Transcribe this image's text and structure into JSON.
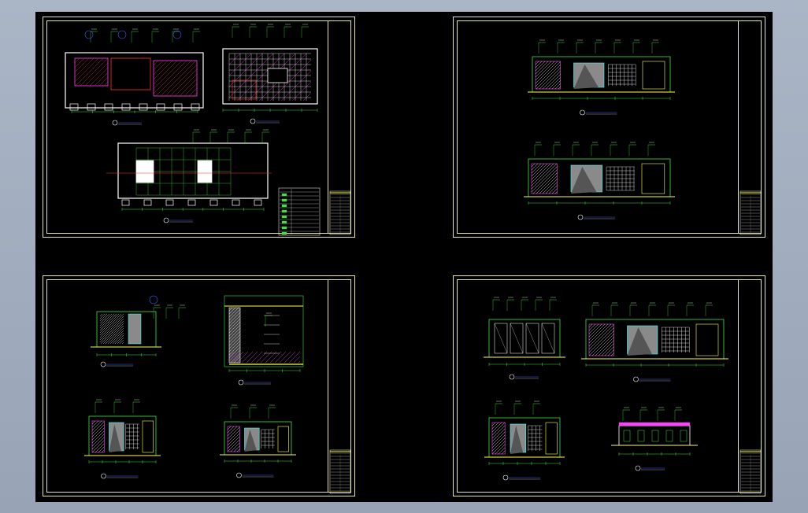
{
  "window": {
    "background": "#a5b1c2",
    "canvas_color": "#000000"
  },
  "colors": {
    "frame": "#e8e8a0",
    "wall": "#ffffff",
    "green": "#40e040",
    "magenta": "#ff40ff",
    "yellow": "#ffff40",
    "cyan": "#40ffff",
    "red": "#ff3030",
    "blue": "#4060ff",
    "gray_fill": "#8a8a8a"
  },
  "sheets": [
    {
      "id": "sheet-1",
      "content": "floor-plans"
    },
    {
      "id": "sheet-2",
      "content": "elevations"
    },
    {
      "id": "sheet-3",
      "content": "details"
    },
    {
      "id": "sheet-4",
      "content": "elevations-and-section"
    }
  ]
}
